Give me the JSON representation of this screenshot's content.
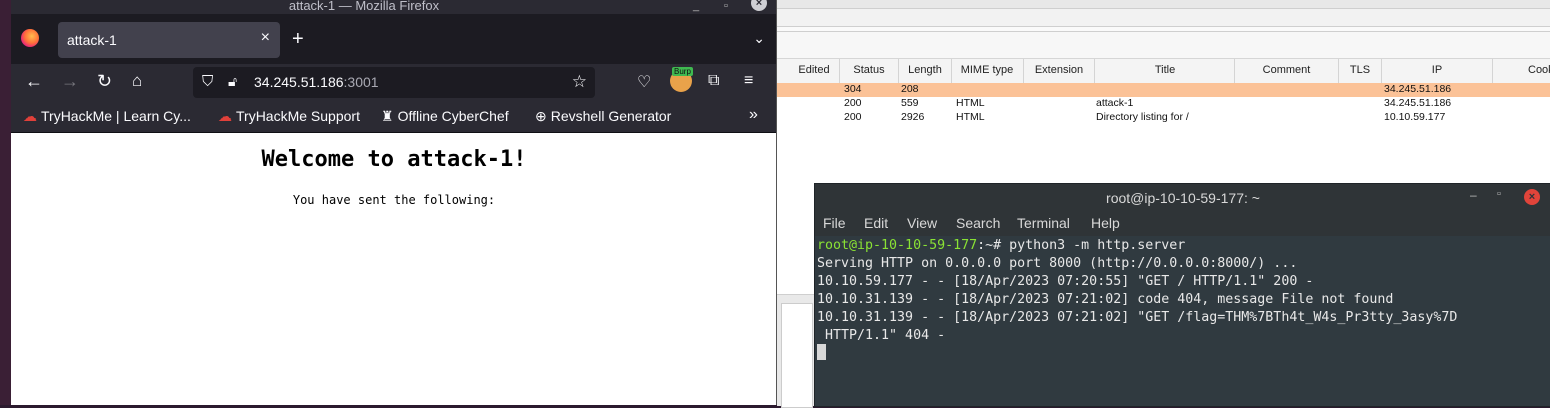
{
  "firefox": {
    "window_title": "attack-1 — Mozilla Firefox",
    "tab_title": "attack-1",
    "tab_close": "×",
    "new_tab": "+",
    "url_host": "34.245.51.186",
    "url_port": ":3001",
    "extension_badge": "Burp",
    "bookmarks": [
      {
        "label": "TryHackMe | Learn Cy...",
        "icon": "cloud-icon"
      },
      {
        "label": "TryHackMe Support",
        "icon": "cloud-icon"
      },
      {
        "label": "Offline CyberChef",
        "icon": "chef-icon"
      },
      {
        "label": "Revshell Generator",
        "icon": "globe-icon"
      }
    ],
    "page": {
      "heading": "Welcome to attack-1!",
      "text": "You have sent the following:"
    }
  },
  "burp": {
    "columns": [
      "Edited",
      "Status",
      "Length",
      "MIME type",
      "Extension",
      "Title",
      "Comment",
      "TLS",
      "IP",
      "Cook"
    ],
    "rows": [
      {
        "status": "304",
        "length": "208",
        "mime": "",
        "title": "",
        "ip": "34.245.51.186",
        "highlight": "#fbc297"
      },
      {
        "status": "200",
        "length": "559",
        "mime": "HTML",
        "title": "attack-1",
        "ip": "34.245.51.186"
      },
      {
        "status": "200",
        "length": "2926",
        "mime": "HTML",
        "title": "Directory listing for /",
        "ip": "10.10.59.177"
      }
    ]
  },
  "terminal": {
    "title": "root@ip-10-10-59-177: ~",
    "menu": [
      "File",
      "Edit",
      "View",
      "Search",
      "Terminal",
      "Help"
    ],
    "prompt": "root@ip-10-10-59-177",
    "prompt_suffix": ":~# python3 -m http.server",
    "lines": [
      "Serving HTTP on 0.0.0.0 port 8000 (http://0.0.0.0:8000/) ...",
      "10.10.59.177 - - [18/Apr/2023 07:20:55] \"GET / HTTP/1.1\" 200 -",
      "10.10.31.139 - - [18/Apr/2023 07:21:02] code 404, message File not found",
      "10.10.31.139 - - [18/Apr/2023 07:21:02] \"GET /flag=THM%7BTh4t_W4s_Pr3tty_3asy%7D",
      " HTTP/1.1\" 404 -"
    ]
  }
}
